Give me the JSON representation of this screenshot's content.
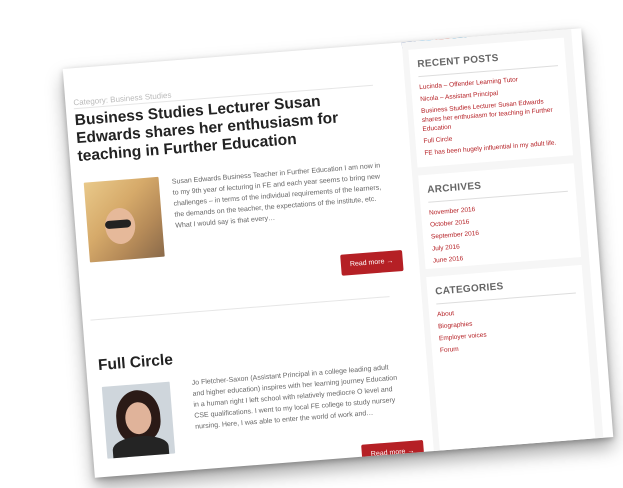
{
  "page": {
    "breadcrumb": "Category: Business Studies"
  },
  "posts": [
    {
      "title": "Business Studies Lecturer Susan Edwards shares her enthusiasm for teaching in Further Education",
      "excerpt": "Susan Edwards Business Teacher in Further Education I am now in to my 9th year of lecturing in FE and each year seems to bring new challenges – in terms of the individual requirements of the learners, the demands on the teacher, the expectations of the institute, etc. What I would say is that every…",
      "read_more": "Read more →"
    },
    {
      "title": "Full Circle",
      "excerpt": "Jo Fletcher-Saxon (Assistant Principal in a college leading adult and higher education) inspires with her learning journey Education in a human right I left school with relatively mediocre O level and CSE qualifications. I went to my local FE college to study nursery nursing. Here, I was able to enter the world of work and…",
      "read_more": "Read more →"
    }
  ],
  "sidebar": {
    "social_icons": [
      "facebook-icon",
      "twitter-icon",
      "google-plus-icon",
      "linkedin-icon"
    ],
    "recent_posts": {
      "title": "RECENT POSTS",
      "items": [
        "Lucinda – Offender Learning Tutor",
        "Nicola – Assistant Principal",
        "Business Studies Lecturer Susan Edwards shares her enthusiasm for teaching in Further Education",
        "Full Circle",
        "FE has been hugely influential in my adult life."
      ]
    },
    "archives": {
      "title": "ARCHIVES",
      "items": [
        "November 2016",
        "October 2016",
        "September 2016",
        "July 2016",
        "June 2016"
      ]
    },
    "categories": {
      "title": "CATEGORIES",
      "items": [
        "About",
        "Biographies",
        "Employer voices",
        "Forum"
      ]
    }
  },
  "colors": {
    "accent": "#b52025",
    "title_text": "#222222",
    "body_text": "#666666"
  }
}
